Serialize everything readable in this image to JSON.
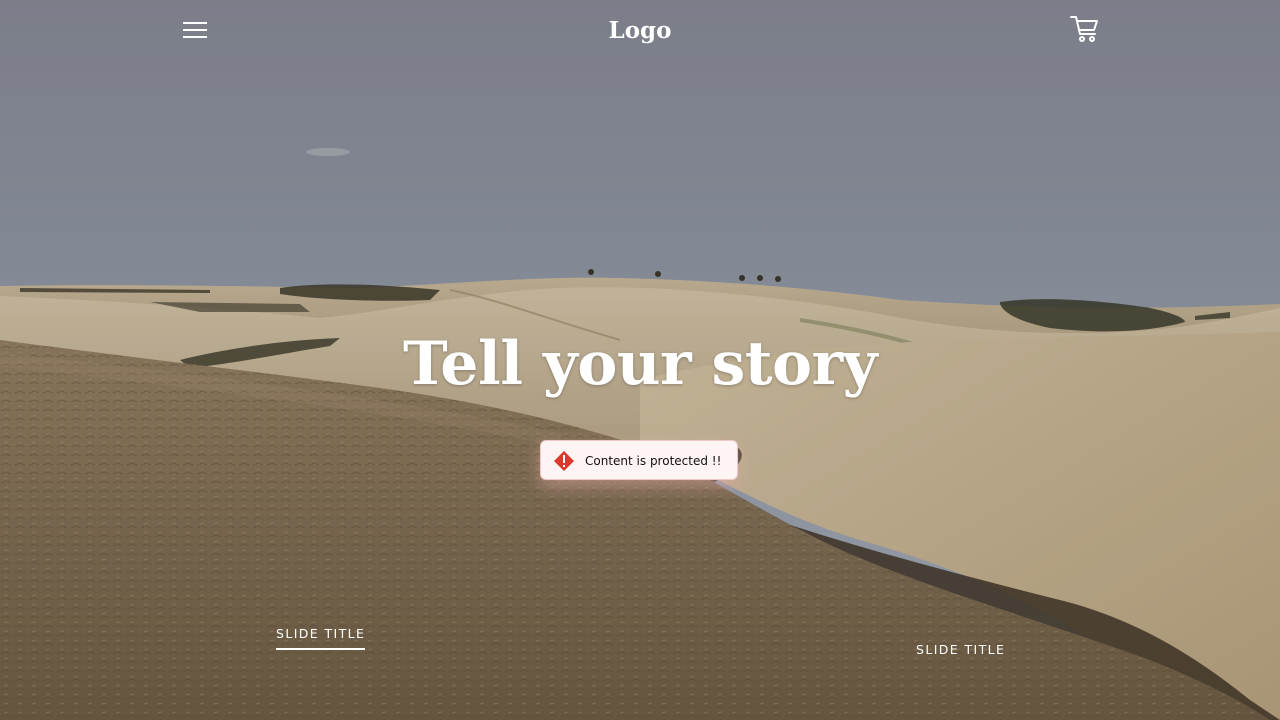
{
  "header": {
    "logo": "Logo",
    "menu_icon": "hamburger-menu-icon",
    "cart_icon": "shopping-cart-icon"
  },
  "hero": {
    "headline": "Tell your story",
    "background": "rolling-hills-landscape"
  },
  "toast": {
    "icon": "warning-diamond-icon",
    "message": "Content is protected !!",
    "accent_color": "#d93a2b"
  },
  "slides": [
    {
      "label": "SLIDE TITLE",
      "active": true
    },
    {
      "label": "SLIDE TITLE",
      "active": false
    }
  ]
}
